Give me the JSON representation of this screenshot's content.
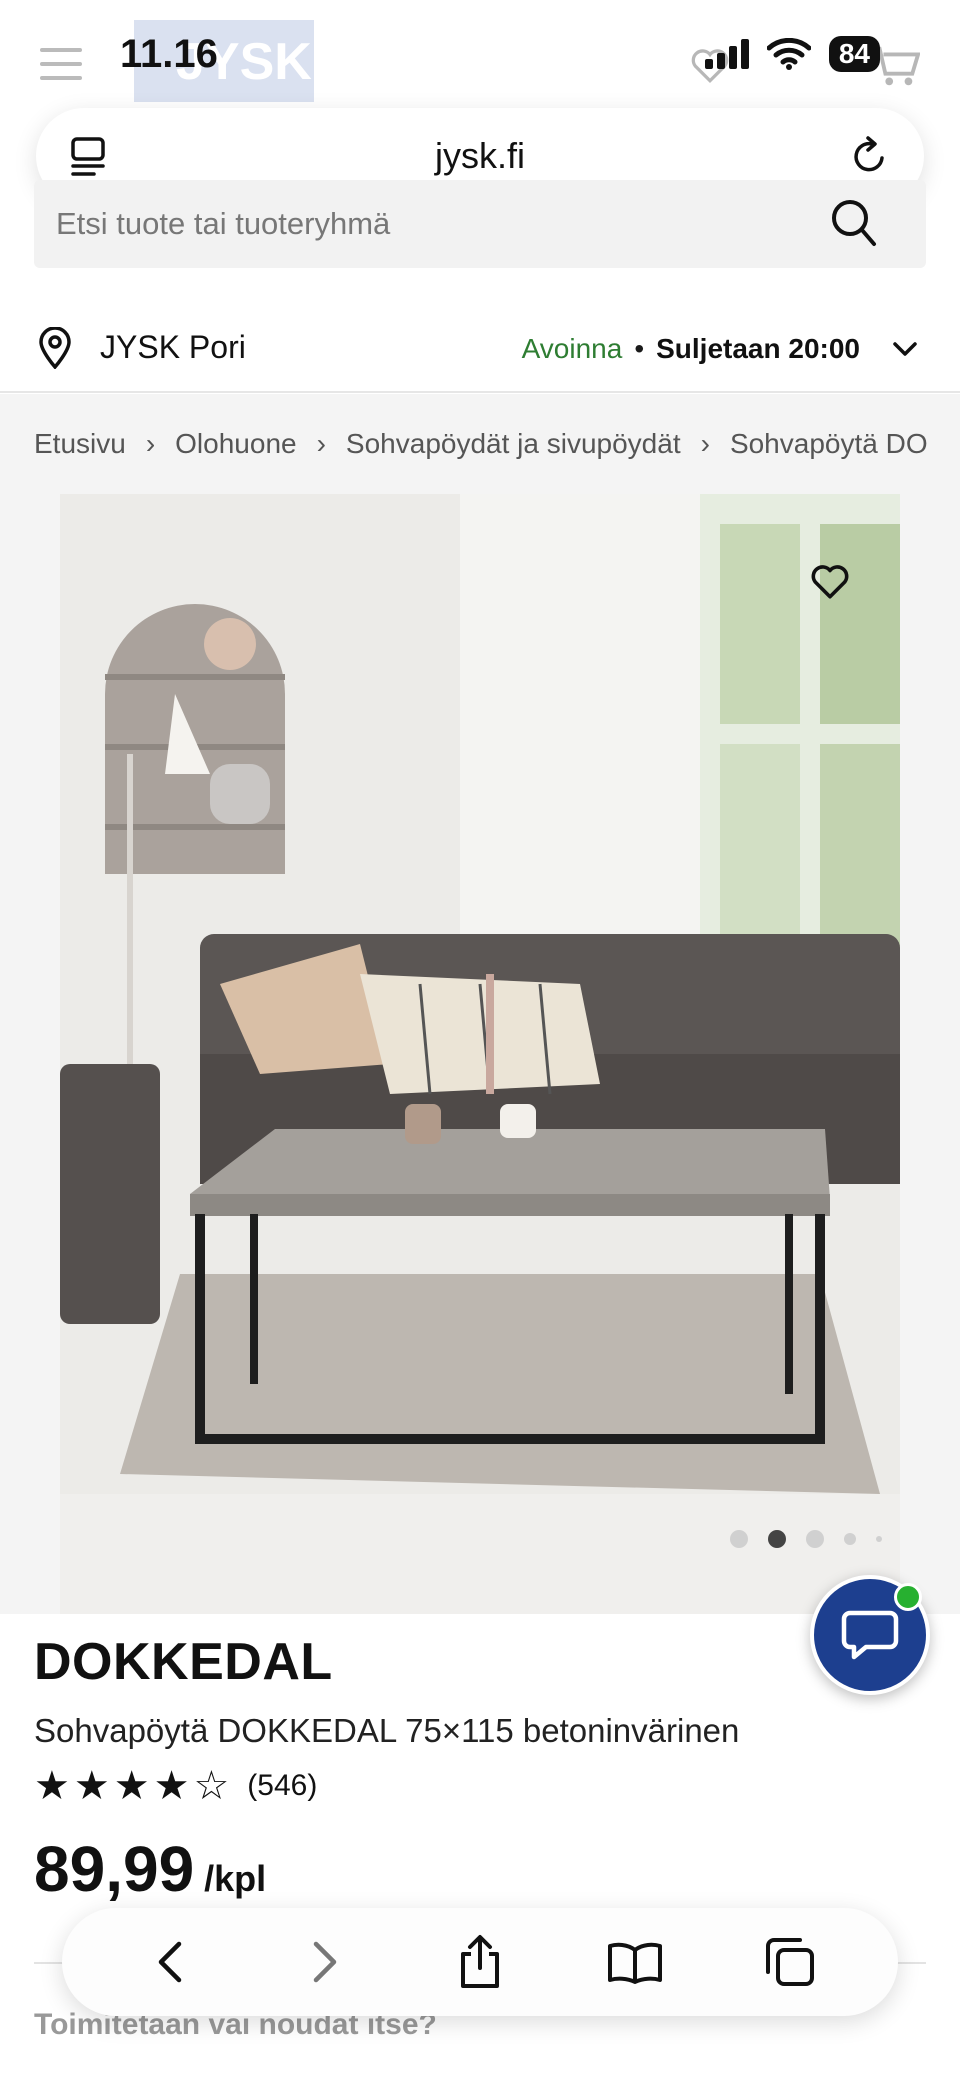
{
  "status_bar": {
    "time": "11.16",
    "battery": "84"
  },
  "header": {
    "logo_text": "JYSK"
  },
  "url_bar": {
    "url": "jysk.fi"
  },
  "search": {
    "placeholder": "Etsi tuote tai tuoteryhmä"
  },
  "store": {
    "name": "JYSK Pori",
    "status_open": "Avoinna",
    "separator": "•",
    "closes": "Suljetaan 20:00"
  },
  "breadcrumbs": [
    {
      "label": "Etusivu"
    },
    {
      "label": "Olohuone"
    },
    {
      "label": "Sohvapöydät ja sivupöydät"
    },
    {
      "label": "Sohvapöytä DO"
    }
  ],
  "breadcrumb_separator": "›",
  "gallery": {
    "active_index": 1,
    "dot_count": 5
  },
  "product": {
    "title": "DOKKEDAL",
    "subtitle": "Sohvapöytä DOKKEDAL 75×115 betoninvärinen",
    "rating": 4,
    "rating_max": 5,
    "rating_count": "(546)",
    "price": "89,99",
    "unit": "/kpl",
    "delivery_question": "Toimitetaan vai noudat itse?"
  },
  "colors": {
    "brand_blue": "#1d3f8f",
    "open_green": "#2e7d32",
    "online_dot": "#27b030"
  },
  "icons": [
    "menu-icon",
    "heart-icon",
    "cart-icon",
    "reader-icon",
    "reload-icon",
    "search-icon",
    "location-pin-icon",
    "chevron-down-icon",
    "favorite-icon",
    "chat-icon",
    "back-icon",
    "forward-icon",
    "share-icon",
    "bookmarks-icon",
    "tabs-icon"
  ]
}
